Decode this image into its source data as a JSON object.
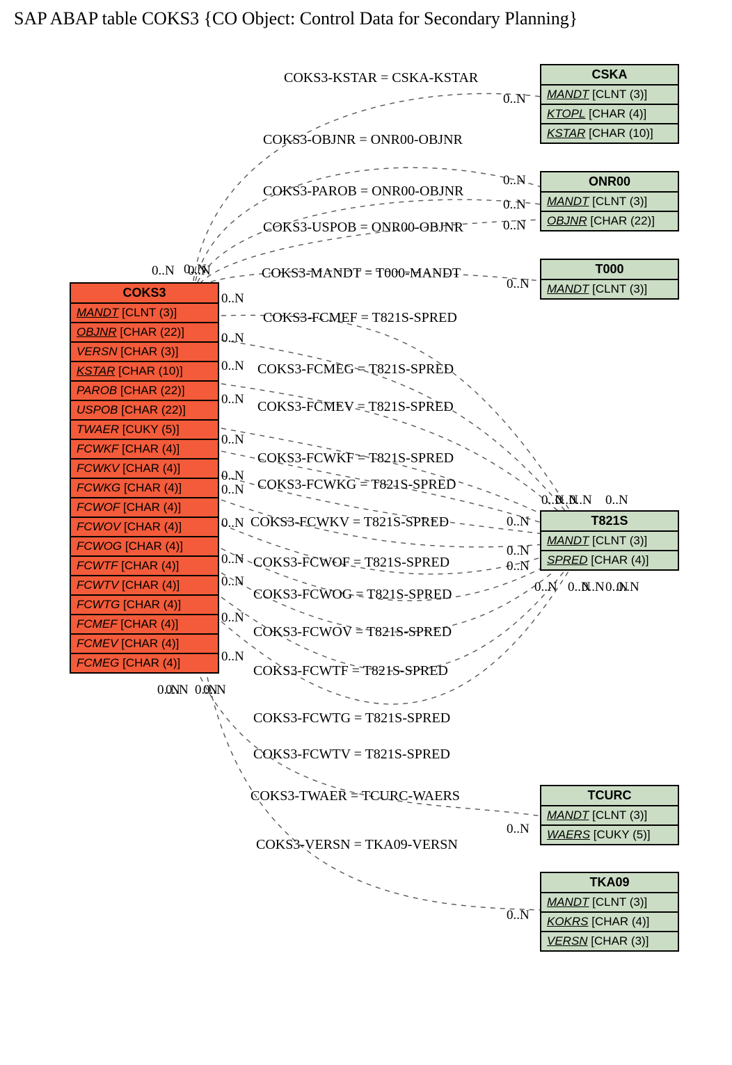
{
  "title": "SAP ABAP table COKS3 {CO Object: Control Data for Secondary Planning}",
  "entities": {
    "coks3": {
      "name": "COKS3",
      "fields": [
        {
          "name": "MANDT",
          "u": true,
          "type": "[CLNT (3)]"
        },
        {
          "name": "OBJNR",
          "u": true,
          "type": "[CHAR (22)]"
        },
        {
          "name": "VERSN",
          "u": false,
          "type": "[CHAR (3)]"
        },
        {
          "name": "KSTAR",
          "u": true,
          "type": "[CHAR (10)]"
        },
        {
          "name": "PAROB",
          "u": false,
          "type": "[CHAR (22)]"
        },
        {
          "name": "USPOB",
          "u": false,
          "type": "[CHAR (22)]"
        },
        {
          "name": "TWAER",
          "u": false,
          "type": "[CUKY (5)]"
        },
        {
          "name": "FCWKF",
          "u": false,
          "type": "[CHAR (4)]"
        },
        {
          "name": "FCWKV",
          "u": false,
          "type": "[CHAR (4)]"
        },
        {
          "name": "FCWKG",
          "u": false,
          "type": "[CHAR (4)]"
        },
        {
          "name": "FCWOF",
          "u": false,
          "type": "[CHAR (4)]"
        },
        {
          "name": "FCWOV",
          "u": false,
          "type": "[CHAR (4)]"
        },
        {
          "name": "FCWOG",
          "u": false,
          "type": "[CHAR (4)]"
        },
        {
          "name": "FCWTF",
          "u": false,
          "type": "[CHAR (4)]"
        },
        {
          "name": "FCWTV",
          "u": false,
          "type": "[CHAR (4)]"
        },
        {
          "name": "FCWTG",
          "u": false,
          "type": "[CHAR (4)]"
        },
        {
          "name": "FCMEF",
          "u": false,
          "type": "[CHAR (4)]"
        },
        {
          "name": "FCMEV",
          "u": false,
          "type": "[CHAR (4)]"
        },
        {
          "name": "FCMEG",
          "u": false,
          "type": "[CHAR (4)]"
        }
      ]
    },
    "cska": {
      "name": "CSKA",
      "fields": [
        {
          "name": "MANDT",
          "u": true,
          "type": "[CLNT (3)]"
        },
        {
          "name": "KTOPL",
          "u": true,
          "type": "[CHAR (4)]"
        },
        {
          "name": "KSTAR",
          "u": true,
          "type": "[CHAR (10)]"
        }
      ]
    },
    "onr00": {
      "name": "ONR00",
      "fields": [
        {
          "name": "MANDT",
          "u": true,
          "type": "[CLNT (3)]"
        },
        {
          "name": "OBJNR",
          "u": true,
          "type": "[CHAR (22)]"
        }
      ]
    },
    "t000": {
      "name": "T000",
      "fields": [
        {
          "name": "MANDT",
          "u": true,
          "type": "[CLNT (3)]"
        }
      ]
    },
    "t821s": {
      "name": "T821S",
      "fields": [
        {
          "name": "MANDT",
          "u": true,
          "type": "[CLNT (3)]"
        },
        {
          "name": "SPRED",
          "u": true,
          "type": "[CHAR (4)]"
        }
      ]
    },
    "tcurc": {
      "name": "TCURC",
      "fields": [
        {
          "name": "MANDT",
          "u": true,
          "type": "[CLNT (3)]"
        },
        {
          "name": "WAERS",
          "u": true,
          "type": "[CUKY (5)]"
        }
      ]
    },
    "tka09": {
      "name": "TKA09",
      "fields": [
        {
          "name": "MANDT",
          "u": true,
          "type": "[CLNT (3)]"
        },
        {
          "name": "KOKRS",
          "u": true,
          "type": "[CHAR (4)]"
        },
        {
          "name": "VERSN",
          "u": true,
          "type": "[CHAR (3)]"
        }
      ]
    }
  },
  "relations": [
    {
      "text": "COKS3-KSTAR = CSKA-KSTAR"
    },
    {
      "text": "COKS3-OBJNR = ONR00-OBJNR"
    },
    {
      "text": "COKS3-PAROB = ONR00-OBJNR"
    },
    {
      "text": "COKS3-USPOB = ONR00-OBJNR"
    },
    {
      "text": "COKS3-MANDT = T000-MANDT"
    },
    {
      "text": "COKS3-FCMEF = T821S-SPRED"
    },
    {
      "text": "COKS3-FCMEG = T821S-SPRED"
    },
    {
      "text": "COKS3-FCMEV = T821S-SPRED"
    },
    {
      "text": "COKS3-FCWKF = T821S-SPRED"
    },
    {
      "text": "COKS3-FCWKG = T821S-SPRED"
    },
    {
      "text": "COKS3-FCWKV = T821S-SPRED"
    },
    {
      "text": "COKS3-FCWOF = T821S-SPRED"
    },
    {
      "text": "COKS3-FCWOG = T821S-SPRED"
    },
    {
      "text": "COKS3-FCWOV = T821S-SPRED"
    },
    {
      "text": "COKS3-FCWTF = T821S-SPRED"
    },
    {
      "text": "COKS3-FCWTG = T821S-SPRED"
    },
    {
      "text": "COKS3-FCWTV = T821S-SPRED"
    },
    {
      "text": "COKS3-TWAER = TCURC-WAERS"
    },
    {
      "text": "COKS3-VERSN = TKA09-VERSN"
    }
  ],
  "cardinality": "0..N"
}
